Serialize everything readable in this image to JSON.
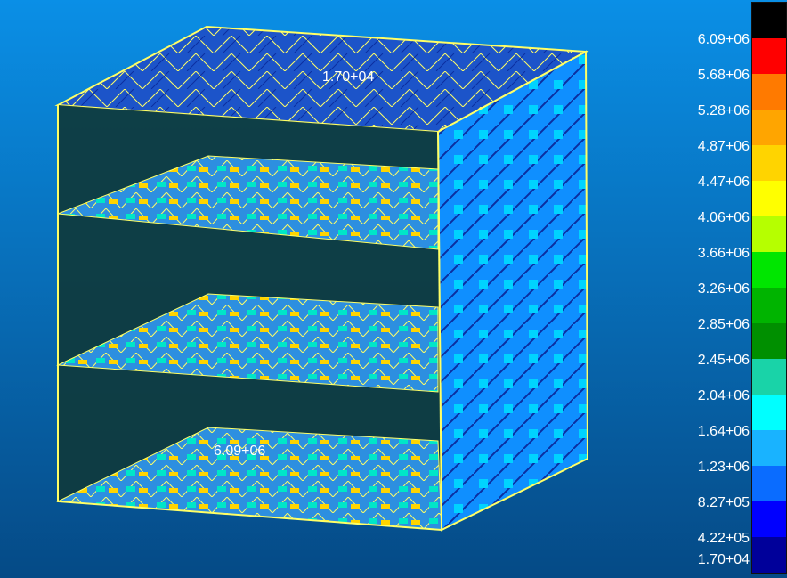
{
  "viewport": {
    "background_top": "#0a8fe6",
    "background_bottom": "#054a86"
  },
  "annotations": {
    "max_label": "1.70+04",
    "min_label": "6.09+06"
  },
  "legend": {
    "labels": [
      "6.09+06",
      "5.68+06",
      "5.28+06",
      "4.87+06",
      "4.47+06",
      "4.06+06",
      "3.66+06",
      "3.26+06",
      "2.85+06",
      "2.45+06",
      "2.04+06",
      "1.64+06",
      "1.23+06",
      "8.27+05",
      "4.22+05",
      "1.70+04"
    ],
    "colors": [
      "#000000",
      "#ff0000",
      "#ff7a00",
      "#ffa500",
      "#ffd400",
      "#ffff00",
      "#b6ff00",
      "#00e600",
      "#00b400",
      "#008f00",
      "#19d3a8",
      "#00ffff",
      "#19b3ff",
      "#0a6cff",
      "#0000ff",
      "#00009a"
    ]
  }
}
